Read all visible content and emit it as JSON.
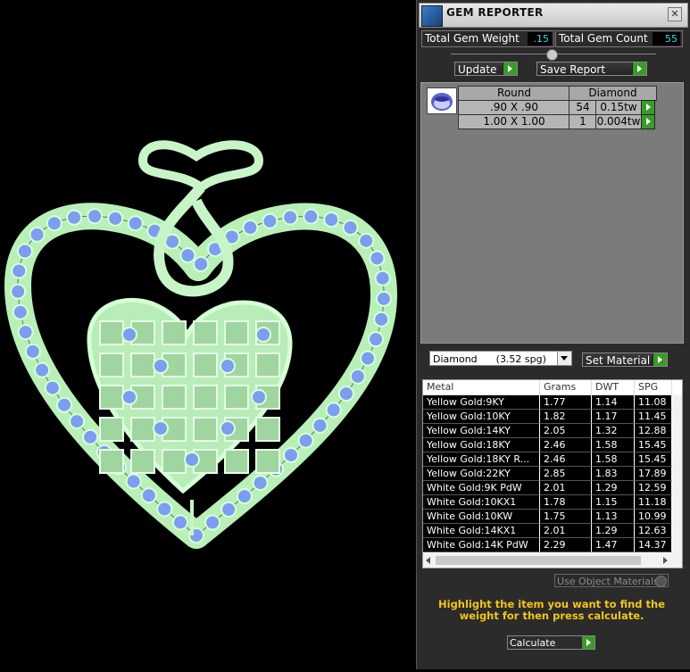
{
  "window": {
    "title": "GEM REPORTER"
  },
  "stats": {
    "weight_label": "Total Gem Weight",
    "weight_value": ".15",
    "count_label": "Total Gem Count",
    "count_value": "55"
  },
  "actions": {
    "update_label": "Update",
    "save_label": "Save Report"
  },
  "gems": {
    "headers": {
      "shape": "Round",
      "type": "Diamond"
    },
    "rows": [
      {
        "size": ".90 X .90",
        "count": "54",
        "weight": "0.15tw"
      },
      {
        "size": "1.00 X 1.00",
        "count": "1",
        "weight": "0.004tw"
      }
    ]
  },
  "material": {
    "selected": "Diamond      (3.52 spg)",
    "set_label": "Set Material"
  },
  "metals": {
    "columns": [
      "Metal",
      "Grams",
      "DWT",
      "SPG"
    ],
    "rows": [
      [
        "Yellow Gold:9KY",
        "1.77",
        "1.14",
        "11.08"
      ],
      [
        "Yellow Gold:10KY",
        "1.82",
        "1.17",
        "11.45"
      ],
      [
        "Yellow Gold:14KY",
        "2.05",
        "1.32",
        "12.88"
      ],
      [
        "Yellow Gold:18KY",
        "2.46",
        "1.58",
        "15.45"
      ],
      [
        "Yellow Gold:18KY R...",
        "2.46",
        "1.58",
        "15.45"
      ],
      [
        "Yellow Gold:22KY",
        "2.85",
        "1.83",
        "17.89"
      ],
      [
        "White Gold:9K PdW",
        "2.01",
        "1.29",
        "12.59"
      ],
      [
        "White Gold:10KX1",
        "1.78",
        "1.15",
        "11.18"
      ],
      [
        "White Gold:10KW",
        "1.75",
        "1.13",
        "10.99"
      ],
      [
        "White Gold:14KX1",
        "2.01",
        "1.29",
        "12.63"
      ],
      [
        "White Gold:14K PdW",
        "2.29",
        "1.47",
        "14.37"
      ]
    ]
  },
  "options": {
    "use_object_materials": "Use Object Materials"
  },
  "hint": "Highlight the item you want to find the weight for then press calculate.",
  "calculate_label": "Calculate",
  "colors": {
    "metal": "#a8e6a8",
    "gem": "#7b9ef0",
    "accent": "#3a9a2a",
    "hint": "#f5c518",
    "value": "#36d9e8"
  }
}
